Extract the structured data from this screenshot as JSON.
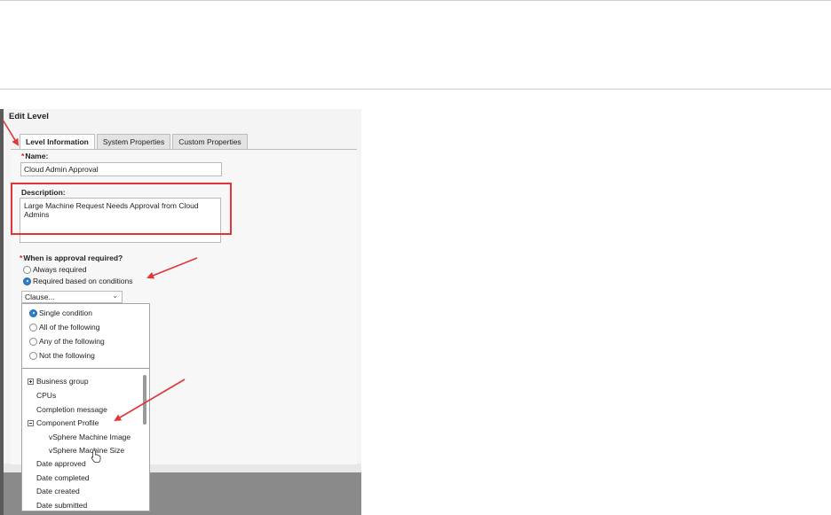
{
  "dialog": {
    "title": "Edit Level",
    "tabs": [
      {
        "label": "Level Information",
        "active": true
      },
      {
        "label": "System Properties",
        "active": false
      },
      {
        "label": "Custom Properties",
        "active": false
      }
    ]
  },
  "form": {
    "required_mark": "*",
    "name_label": "Name:",
    "name_value": "Cloud Admin Approval",
    "description_label": "Description:",
    "description_value": "Large Machine Request Needs Approval from Cloud Admins",
    "approval_question": "When is approval required?",
    "approval_options": [
      {
        "label": "Always required",
        "selected": false
      },
      {
        "label": "Required based on conditions",
        "selected": true
      }
    ],
    "clause_select_value": "Clause...",
    "clause_options": [
      {
        "label": "Single condition",
        "selected": true
      },
      {
        "label": "All of the following",
        "selected": false
      },
      {
        "label": "Any of the following",
        "selected": false
      },
      {
        "label": "Not the following",
        "selected": false
      }
    ],
    "field_list": [
      {
        "label": "Business group",
        "expander": "plus"
      },
      {
        "label": "CPUs"
      },
      {
        "label": "Completion message"
      },
      {
        "label": "Component Profile",
        "expander": "minus"
      },
      {
        "label": "vSphere Machine Image"
      },
      {
        "label": "vSphere Machine Size"
      },
      {
        "label": "Date approved"
      },
      {
        "label": "Date completed"
      },
      {
        "label": "Date created"
      },
      {
        "label": "Date submitted"
      }
    ]
  },
  "colors": {
    "accent_red": "#e0363a",
    "radio_selected": "#2f7fd0"
  }
}
